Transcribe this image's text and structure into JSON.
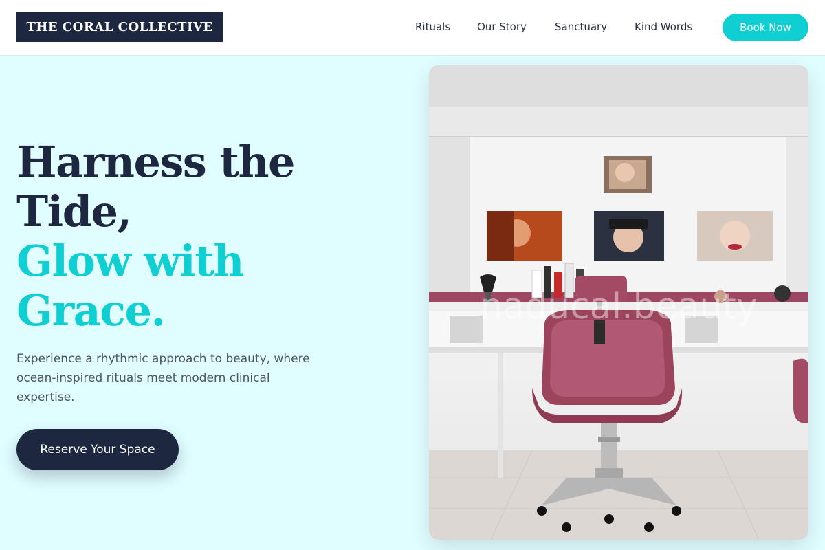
{
  "header": {
    "logo": "THE CORAL COLLECTIVE",
    "nav": [
      {
        "label": "Rituals"
      },
      {
        "label": "Our Story"
      },
      {
        "label": "Sanctuary"
      },
      {
        "label": "Kind Words"
      }
    ],
    "book_label": "Book Now"
  },
  "hero": {
    "title_dark_1": "Harness the",
    "title_dark_2": "Tide,",
    "title_teal_1": "Glow with",
    "title_teal_2": "Grace.",
    "description": "Experience a rhythmic approach to beauty, where ocean-inspired rituals meet modern clinical expertise.",
    "cta_label": "Reserve Your Space"
  },
  "photo": {
    "watermark": "naducal.beauty"
  },
  "colors": {
    "navy": "#1e2740",
    "teal": "#0fcfd3",
    "background": "#e0fdff",
    "chair": "#a34b64"
  }
}
